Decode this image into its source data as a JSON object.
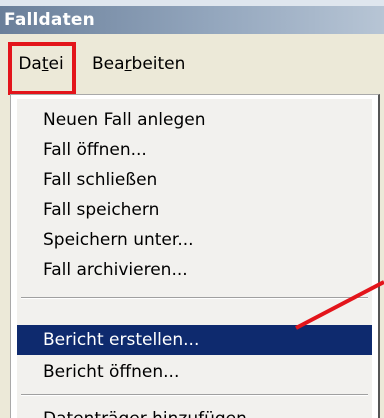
{
  "window": {
    "title": "Falldaten"
  },
  "menubar": {
    "items": [
      {
        "label_pre": "Da",
        "label_accel": "t",
        "label_post": "ei"
      },
      {
        "label_pre": "Bea",
        "label_accel": "r",
        "label_post": "beiten"
      }
    ]
  },
  "dropdown": {
    "items": [
      {
        "label": "Neuen Fall anlegen"
      },
      {
        "label": "Fall öffnen..."
      },
      {
        "label": "Fall schließen"
      },
      {
        "label": "Fall speichern"
      },
      {
        "label": "Speichern unter..."
      },
      {
        "label": "Fall archivieren..."
      },
      {
        "label": "Bericht erstellen..."
      },
      {
        "label": "Bericht öffnen..."
      },
      {
        "label": "Datenträger hinzufügen"
      }
    ],
    "selected_index": 6
  },
  "colors": {
    "annotation_red": "#e3151b",
    "selection_bg": "#0e2a6e"
  }
}
